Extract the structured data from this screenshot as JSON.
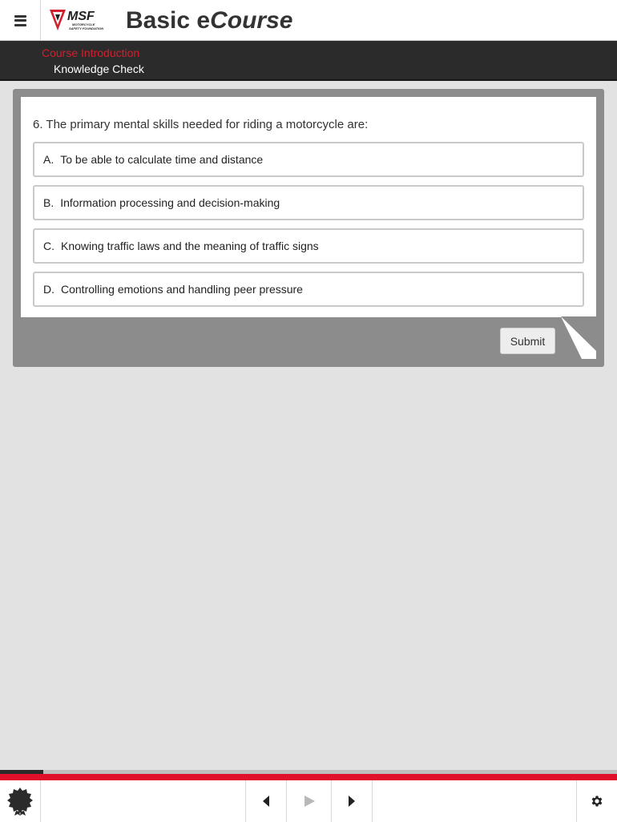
{
  "header": {
    "menu_icon": "hamburger-menu-icon",
    "logo_text": "MSF",
    "logo_subtext": "MOTORCYCLE SAFETY FOUNDATION",
    "title_prefix": "Basic e",
    "title_suffix": "Course"
  },
  "breadcrumb": {
    "course": "Course Introduction",
    "page": "Knowledge Check"
  },
  "quiz": {
    "question": "6. The primary mental skills needed for riding a motorcycle are:",
    "options": [
      {
        "letter": "A.",
        "text": "To be able to calculate time and distance"
      },
      {
        "letter": "B.",
        "text": "Information processing and decision-making"
      },
      {
        "letter": "C.",
        "text": "Knowing traffic laws and the meaning of traffic signs"
      },
      {
        "letter": "D.",
        "text": "Controlling emotions and handling peer pressure"
      }
    ],
    "submit_label": "Submit"
  },
  "progress": {
    "fraction": 0.07
  },
  "footer": {
    "badge_icon": "award-badge-icon",
    "prev_icon": "previous-arrow-icon",
    "play_icon": "play-icon",
    "next_icon": "next-arrow-icon",
    "settings_icon": "gear-icon"
  },
  "colors": {
    "accent_red": "#e0102a",
    "crumb_red": "#d0202e",
    "dark_bar": "#2b2b2b",
    "card_frame": "#8c8c8c",
    "background": "#e2e2e2"
  }
}
